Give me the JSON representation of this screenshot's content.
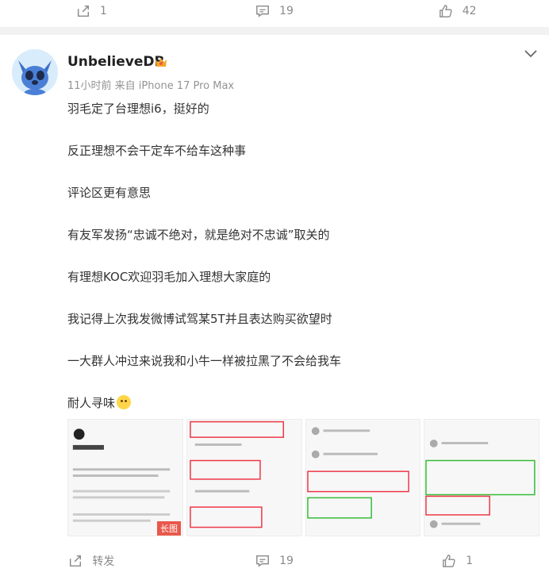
{
  "prev_post_actions": {
    "share_count": "1",
    "comment_count": "19",
    "like_count": "42"
  },
  "post": {
    "username": "UnbelieveDB",
    "meta": "11小时前 来自 iPhone 17 Pro Max",
    "lines": [
      "羽毛定了台理想i6，挺好的",
      "反正理想不会干定车不给车这种事",
      "评论区更有意思",
      "有友军发扬“忠诚不绝对，就是绝对不忠诚”取关的",
      "有理想KOC欢迎羽毛加入理想大家庭的",
      "我记得上次我发微博试驾某5T并且表达购买欲望时",
      "一大群人冲过来说我和小牛一样被拉黑了不会给我车",
      "耐人寻味"
    ],
    "images": {
      "long_image_badge": "长图",
      "thumbnail_count": 4,
      "more_badge": ""
    }
  },
  "post_actions": {
    "share_label": "转发",
    "comment_count": "19",
    "like_count": "1"
  },
  "colors": {
    "vip_badge": "#f5a623",
    "long_badge": "#e9584b",
    "meta_text": "#939393"
  }
}
